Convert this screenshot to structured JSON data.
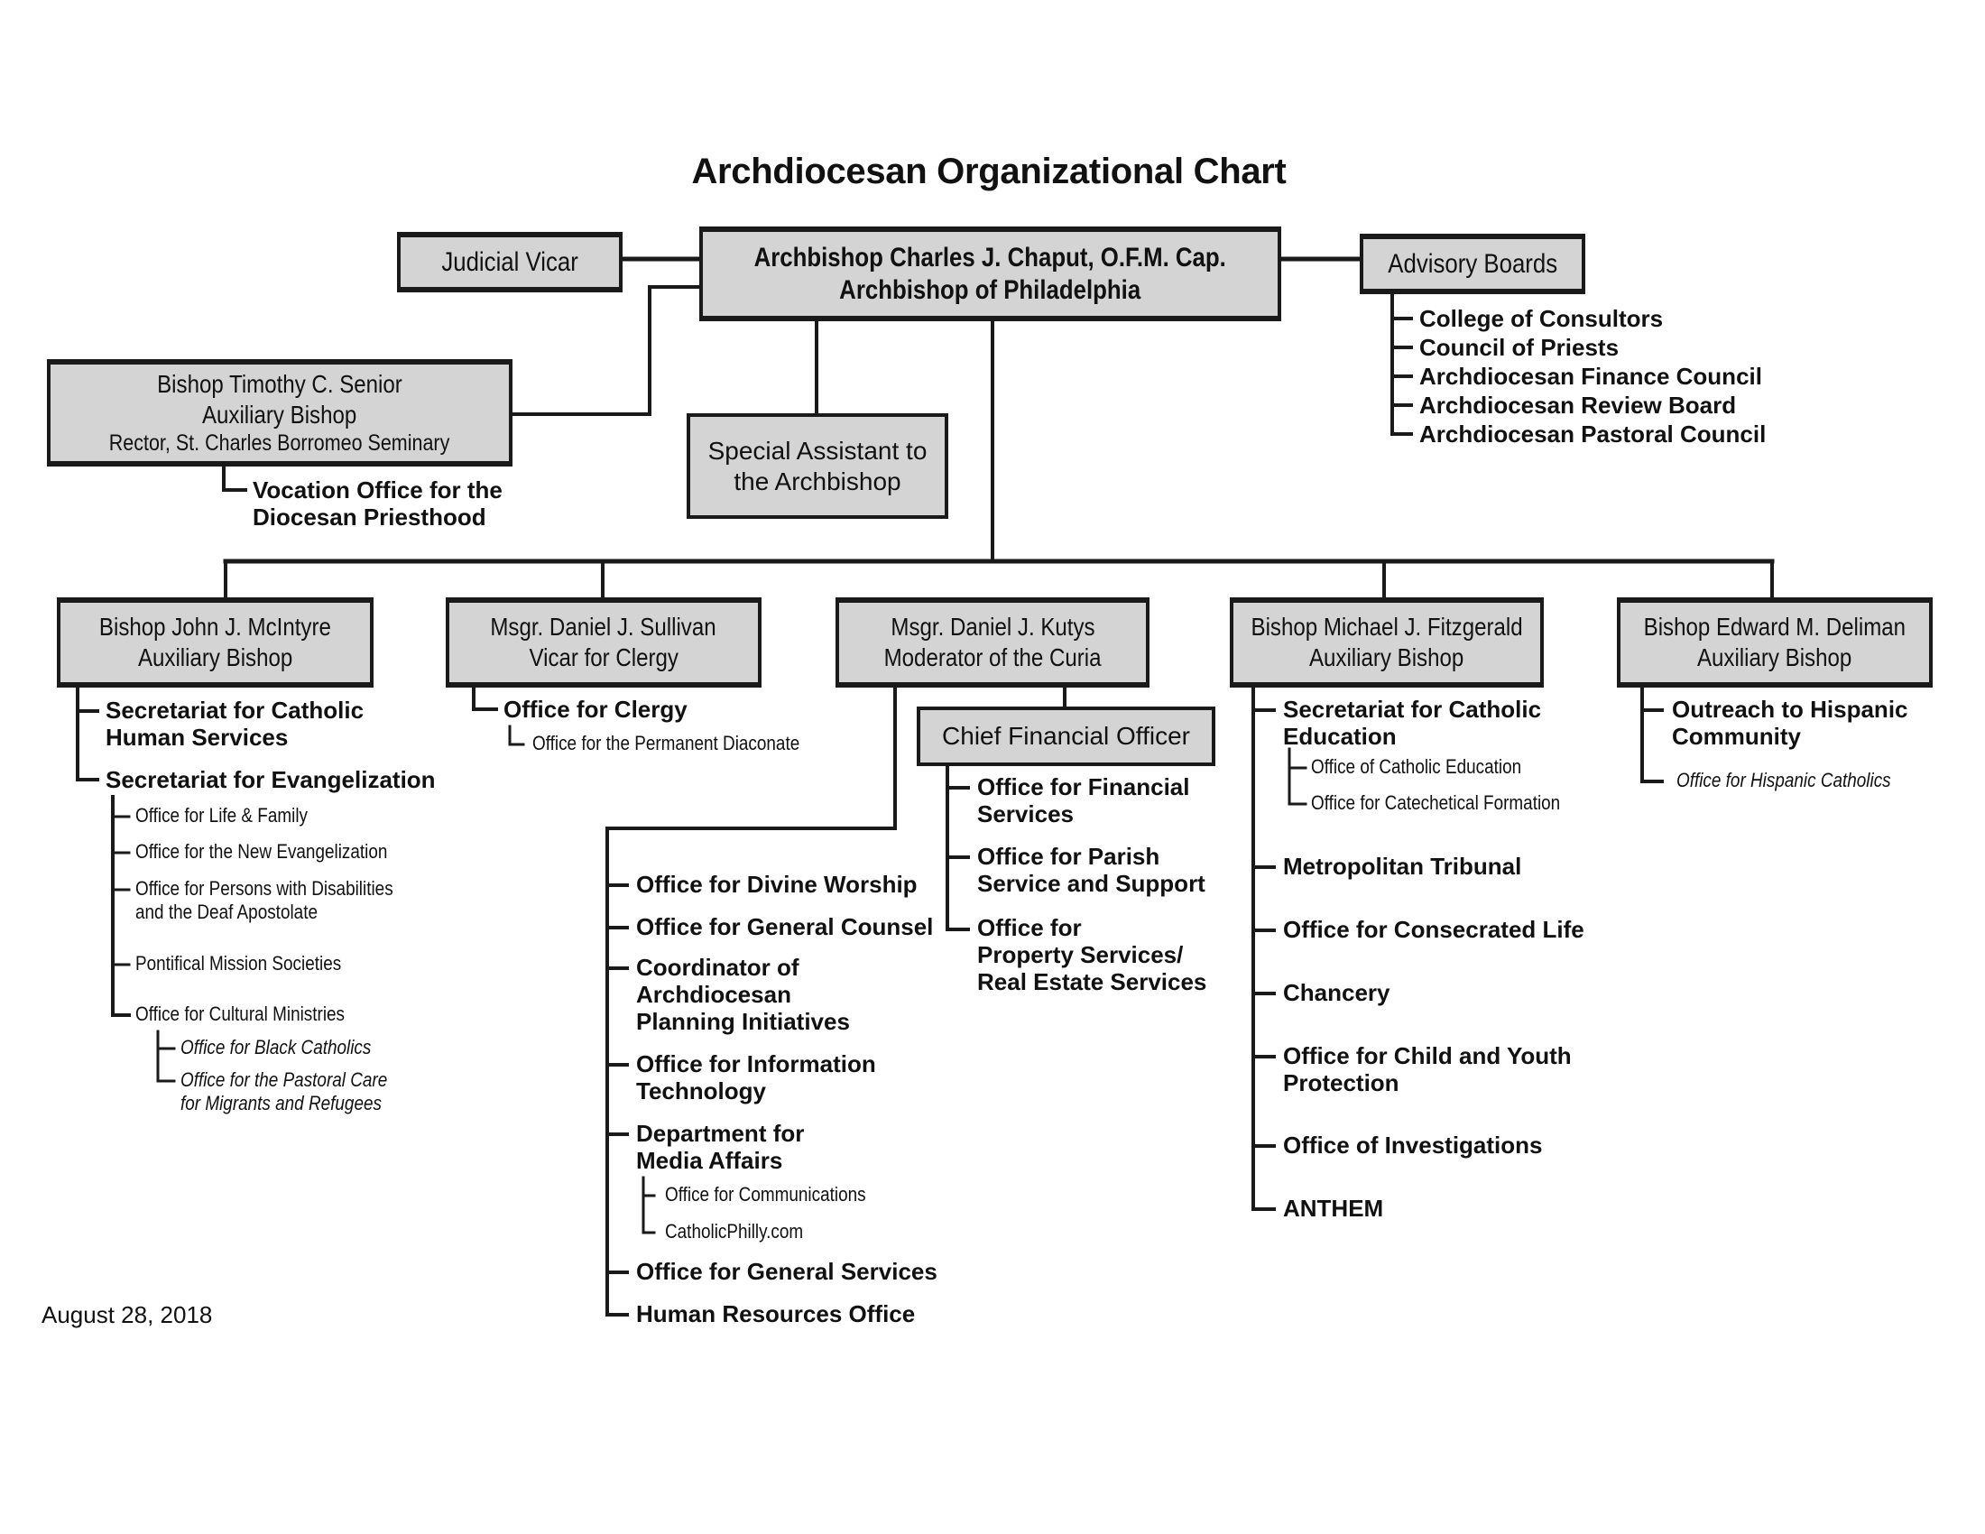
{
  "title": "Archdiocesan Organizational Chart",
  "date": "August 28, 2018",
  "archbishop": {
    "line1": "Archbishop Charles J. Chaput, O.F.M. Cap.",
    "line2": "Archbishop of Philadelphia"
  },
  "judicial_vicar": "Judicial Vicar",
  "advisory_boards": {
    "label": "Advisory Boards",
    "items": [
      "College of Consultors",
      "Council of Priests",
      "Archdiocesan Finance Council",
      "Archdiocesan Review Board",
      "Archdiocesan Pastoral Council"
    ]
  },
  "senior": {
    "line1": "Bishop Timothy C. Senior",
    "line2": "Auxiliary Bishop",
    "line3": "Rector, St. Charles Borromeo Seminary",
    "child_line1": "Vocation Office for the",
    "child_line2": "Diocesan Priesthood"
  },
  "special_assistant": {
    "line1": "Special Assistant to",
    "line2": "the Archbishop"
  },
  "mcintyre": {
    "line1": "Bishop John J. McIntyre",
    "line2": "Auxiliary Bishop",
    "sec_human_1": "Secretariat for Catholic",
    "sec_human_2": "Human Services",
    "sec_evang": "Secretariat for Evangelization",
    "offices": {
      "life_family": "Office for Life & Family",
      "new_evang": "Office for the New Evangelization",
      "disabilities_1": "Office for Persons with Disabilities",
      "disabilities_2": "and the Deaf Apostolate",
      "pontifical": "Pontifical Mission Societies",
      "cultural": "Office for Cultural Ministries",
      "black_catholics": "Office for Black Catholics",
      "migrants_1": "Office for the Pastoral Care",
      "migrants_2": "for Migrants and Refugees"
    }
  },
  "sullivan": {
    "line1": "Msgr. Daniel J. Sullivan",
    "line2": "Vicar for Clergy",
    "office_clergy": "Office for Clergy",
    "diaconate": "Office for the Permanent Diaconate"
  },
  "kutys": {
    "line1": "Msgr. Daniel J. Kutys",
    "line2": "Moderator of the Curia",
    "items": {
      "divine_worship": "Office for Divine Worship",
      "general_counsel": "Office for General Counsel",
      "coord_1": "Coordinator of",
      "coord_2": "Archdiocesan",
      "coord_3": "Planning Initiatives",
      "it_1": "Office for Information",
      "it_2": "Technology",
      "media_1": "Department for",
      "media_2": "Media Affairs",
      "communications": "Office for Communications",
      "catholicphilly": "CatholicPhilly.com",
      "general_services": "Office for General Services",
      "hr": "Human Resources Office"
    }
  },
  "cfo": {
    "label": "Chief Financial Officer",
    "fin_1": "Office for Financial",
    "fin_2": "Services",
    "parish_1": "Office for Parish",
    "parish_2": "Service and Support",
    "prop_1": "Office for",
    "prop_2": "Property Services/",
    "prop_3": "Real Estate Services"
  },
  "fitzgerald": {
    "line1": "Bishop Michael J. Fitzgerald",
    "line2": "Auxiliary Bishop",
    "sec_ed_1": "Secretariat for Catholic",
    "sec_ed_2": "Education",
    "catholic_ed": "Office of Catholic Education",
    "catechetical": "Office for Catechetical Formation",
    "tribunal": "Metropolitan Tribunal",
    "consecrated": "Office for Consecrated Life",
    "chancery": "Chancery",
    "child_1": "Office for Child and Youth",
    "child_2": "Protection",
    "investigations": "Office of Investigations",
    "anthem": "ANTHEM"
  },
  "deliman": {
    "line1": "Bishop Edward M. Deliman",
    "line2": "Auxiliary Bishop",
    "outreach_1": "Outreach to Hispanic",
    "outreach_2": "Community",
    "hispanic_catholics": "Office for Hispanic Catholics"
  },
  "colors": {
    "box_fill": "#d4d4d4",
    "line": "#1a1a1a",
    "text": "#111111"
  }
}
